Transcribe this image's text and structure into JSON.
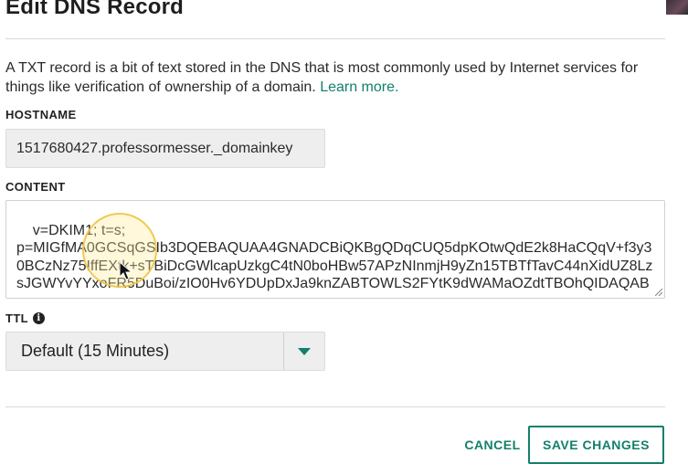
{
  "dialog": {
    "title": "Edit DNS Record",
    "description": "A TXT record is a bit of text stored in the DNS that is most commonly used by Internet services for things like verification of ownership of a domain.",
    "learn_more_label": "Learn more."
  },
  "hostname": {
    "label": "HOSTNAME",
    "value": "1517680427.professormesser._domainkey"
  },
  "content": {
    "label": "CONTENT",
    "value": "v=DKIM1; t=s;\np=MIGfMA0GCSqGSIb3DQEBAQUAA4GNADCBiQKBgQDqCUQ5dpKOtwQdE2k8HaCQqV+f3y30BCzNz75IffEXtk+sTBiDcGWlcapUzkgC4tN0boHBw57APzNInmjH9yZn15TBTfTavC44nXidUZ8LzsJGWYvYYxoFR5DuBoi/zIO0Hv6YDUpDxJa9knZABTOWLS2FYtK9dWAMaOZdtTBOhQIDAQAB"
  },
  "ttl": {
    "label": "TTL",
    "info_icon": "info-icon",
    "selected": "Default (15 Minutes)",
    "arrow_icon": "chevron-down-icon"
  },
  "actions": {
    "cancel_label": "CANCEL",
    "save_label": "SAVE CHANGES"
  },
  "colors": {
    "accent": "#13806b",
    "field_background": "#eeeeee",
    "text": "#222222"
  }
}
